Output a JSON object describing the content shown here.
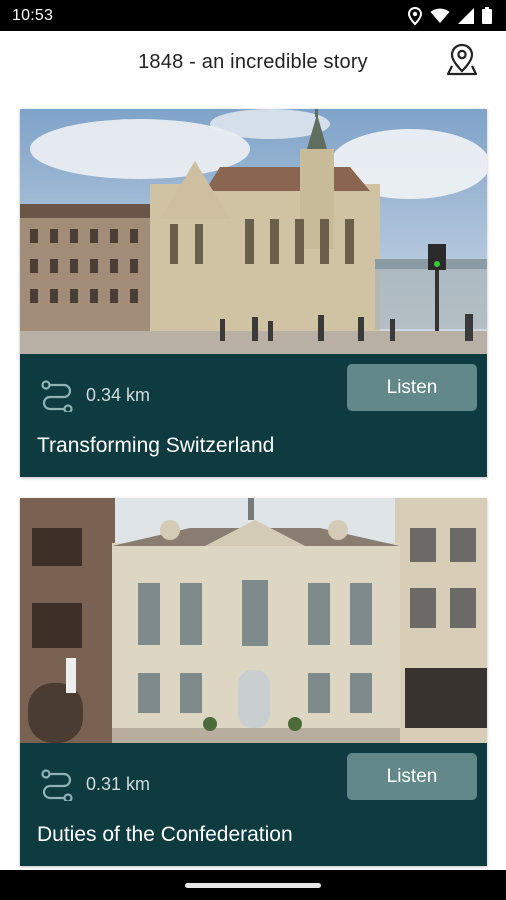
{
  "status_bar": {
    "time": "10:53",
    "icons": [
      "location-icon",
      "wifi-icon",
      "signal-icon",
      "battery-icon"
    ]
  },
  "header": {
    "title": "1848 - an incredible story",
    "map_icon": "map-pin-icon"
  },
  "cards": [
    {
      "image": "church-square-photo",
      "route_icon": "route-icon",
      "distance": "0.34 km",
      "listen_label": "Listen",
      "title": "Transforming Switzerland"
    },
    {
      "image": "historic-building-photo",
      "route_icon": "route-icon",
      "distance": "0.31 km",
      "listen_label": "Listen",
      "title": "Duties of the Confederation"
    }
  ],
  "colors": {
    "card_footer": "#0d3b40",
    "listen_button": "#62888a",
    "distance_text": "#cfdcdd"
  }
}
